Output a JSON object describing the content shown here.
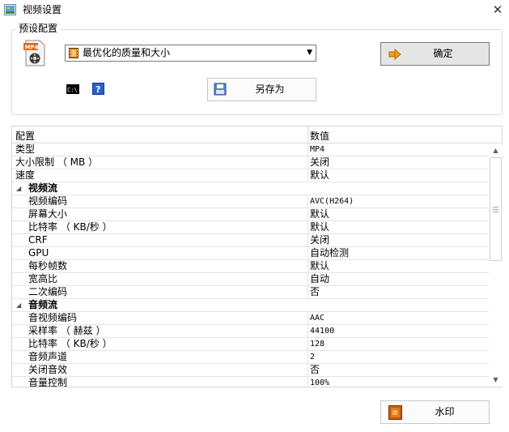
{
  "window": {
    "title": "视频设置",
    "close_glyph": "✕"
  },
  "preset": {
    "group_label": "预设配置",
    "selected": "最优化的质量和大小",
    "confirm_label": "确定",
    "save_as_label": "另存为",
    "cmd_icon_text": "C:\\"
  },
  "grid": {
    "header_name": "配置",
    "header_value": "数值",
    "rows": [
      {
        "name": "类型",
        "value": "MP4"
      },
      {
        "name": "大小限制 （ MB ）",
        "value": "关闭"
      },
      {
        "name": "速度",
        "value": "默认"
      },
      {
        "name": "视频流",
        "category": true
      },
      {
        "name": "视频编码",
        "value": "AVC(H264)"
      },
      {
        "name": "屏幕大小",
        "value": "默认"
      },
      {
        "name": "比特率 （ KB/秒 ）",
        "value": "默认"
      },
      {
        "name": "CRF",
        "value": "关闭"
      },
      {
        "name": "GPU",
        "value": "自动检测"
      },
      {
        "name": "每秒帧数",
        "value": "默认"
      },
      {
        "name": "宽高比",
        "value": "自动"
      },
      {
        "name": "二次编码",
        "value": "否"
      },
      {
        "name": "音频流",
        "category": true
      },
      {
        "name": "音视频编码",
        "value": "AAC"
      },
      {
        "name": "采样率 （ 赫兹 ）",
        "value": "44100"
      },
      {
        "name": "比特率 （ KB/秒 ）",
        "value": "128"
      },
      {
        "name": "音频声道",
        "value": "2"
      },
      {
        "name": "关闭音效",
        "value": "否"
      },
      {
        "name": "音量控制",
        "value": "100%"
      }
    ]
  },
  "watermark": {
    "label": "水印"
  }
}
